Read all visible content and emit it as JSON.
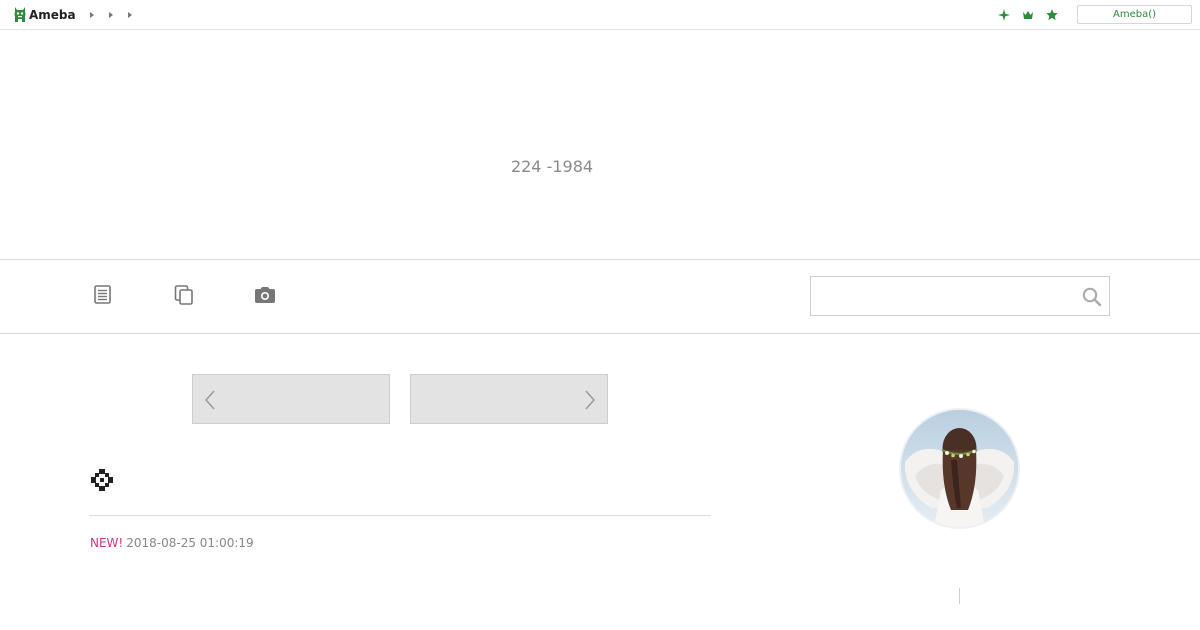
{
  "topbar": {
    "logo_text": "Ameba",
    "login_label": "Ameba()",
    "icons": [
      "sparkle-icon",
      "crown-icon",
      "star-icon"
    ],
    "accent_color": "#2d8c3c"
  },
  "header": {
    "title": "224 -1984"
  },
  "nav": {
    "items": [
      "entries-list-icon",
      "theme-pages-icon",
      "photo-camera-icon"
    ],
    "search_placeholder": ""
  },
  "pager": {
    "prev_label": "",
    "next_label": ""
  },
  "entry": {
    "new_badge": "NEW!",
    "date": "2018-08-25 01:00:19",
    "new_color": "#d6337e"
  },
  "profile": {
    "avatar": "profile-avatar"
  }
}
